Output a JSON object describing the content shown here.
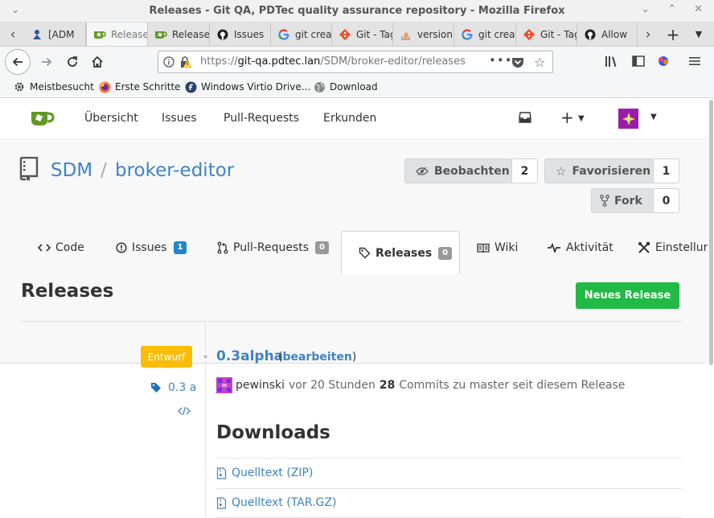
{
  "window": {
    "title": "Releases - Git QA, PDTec quality assurance repository - Mozilla Firefox"
  },
  "tabs": [
    {
      "label": "[ADM",
      "icon": "admin-icon"
    },
    {
      "label": "Releases",
      "icon": "gitea-icon",
      "active": true
    },
    {
      "label": "Releases",
      "icon": "gitea-icon"
    },
    {
      "label": "Issues",
      "icon": "github-icon"
    },
    {
      "label": "git create",
      "icon": "google-icon"
    },
    {
      "label": "Git - Tagging",
      "icon": "git-icon"
    },
    {
      "label": "versioning",
      "icon": "stackoverflow-icon"
    },
    {
      "label": "git create",
      "icon": "google-icon"
    },
    {
      "label": "Git - Tagging",
      "icon": "git-icon"
    },
    {
      "label": "Allow",
      "icon": "github-icon"
    }
  ],
  "url": {
    "prefix": "https://",
    "host": "git-qa.pdtec.lan",
    "path": "/SDM/broker-editor/releases"
  },
  "bookmarks": [
    {
      "label": "Meistbesucht",
      "icon": "gear-icon"
    },
    {
      "label": "Erste Schritte",
      "icon": "firefox-icon"
    },
    {
      "label": "Windows Virtio Drive...",
      "icon": "fedora-icon"
    },
    {
      "label": "Download",
      "icon": "globe-icon"
    }
  ],
  "gitea_nav": {
    "items": [
      "Übersicht",
      "Issues",
      "Pull-Requests",
      "Erkunden"
    ]
  },
  "repo": {
    "owner": "SDM",
    "separator": "/",
    "name": "broker-editor",
    "watch": {
      "label": "Beobachten",
      "count": "2"
    },
    "star": {
      "label": "Favorisieren",
      "count": "1"
    },
    "fork": {
      "label": "Fork",
      "count": "0"
    }
  },
  "repo_tabs": [
    {
      "label": "Code"
    },
    {
      "label": "Issues",
      "badge": "1"
    },
    {
      "label": "Pull-Requests",
      "badge": "0"
    },
    {
      "label": "Releases",
      "badge": "0",
      "active": true
    },
    {
      "label": "Wiki"
    },
    {
      "label": "Aktivität"
    },
    {
      "label": "Einstellungen"
    }
  ],
  "releases": {
    "title": "Releases",
    "new_button": "Neues Release",
    "items": [
      {
        "status": "Entwurf",
        "tag": "0.3 a",
        "title": "0.3alpha",
        "edit_open": "(",
        "edit_label": "bearbeiten",
        "edit_close": ")",
        "author": "pewinski",
        "time": "vor 20 Stunden",
        "commits": "28",
        "commits_text": "Commits zu master seit diesem Release"
      }
    ],
    "downloads_title": "Downloads",
    "downloads": [
      "Quelltext (ZIP)",
      "Quelltext (TAR.GZ)"
    ]
  },
  "colors": {
    "accent": "#4183c4",
    "success": "#21ba45",
    "warning": "#fbbd08",
    "badge_blue": "#2185d0"
  }
}
